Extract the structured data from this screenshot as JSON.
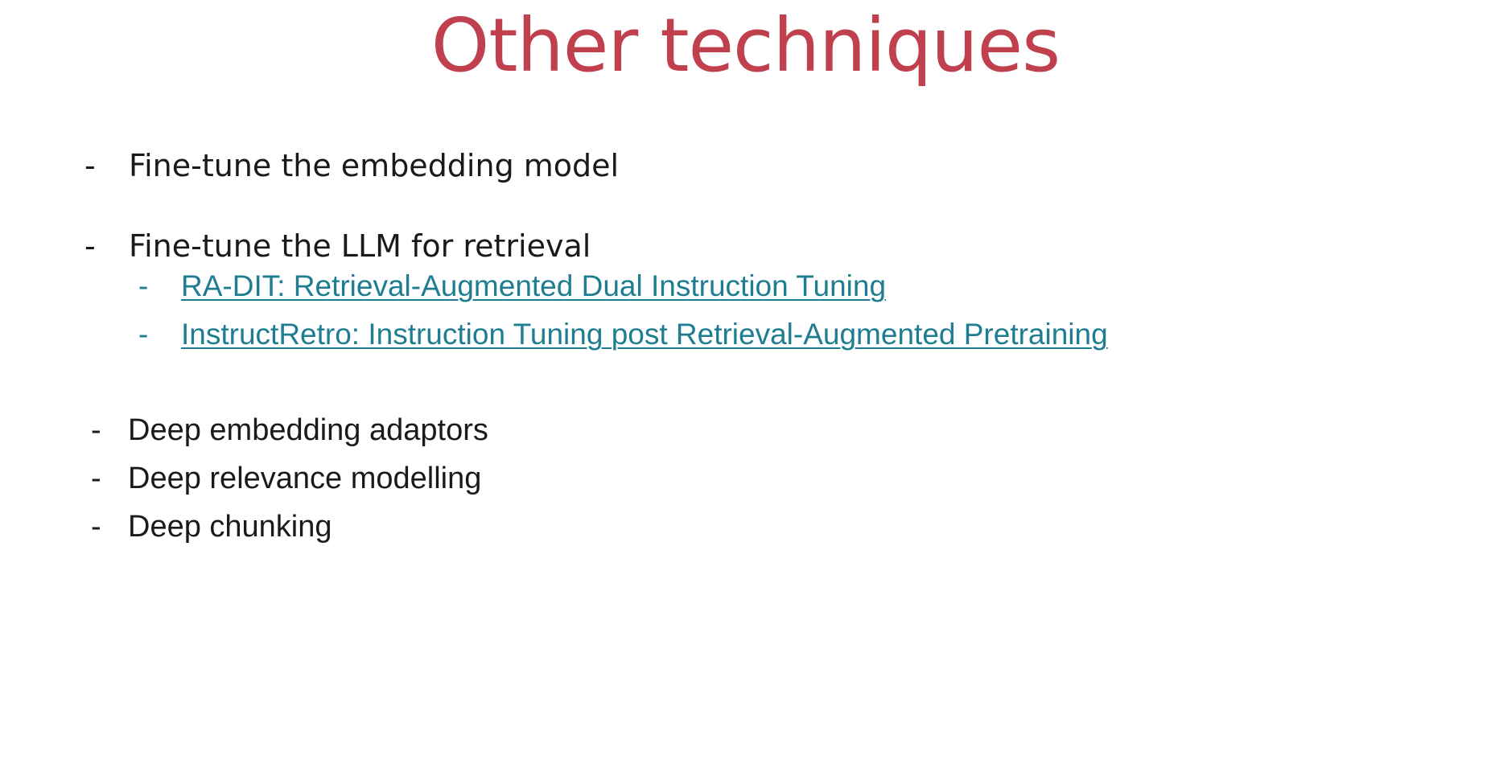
{
  "slide": {
    "title": "Other techniques",
    "bullet_marker": "-",
    "top_items": [
      {
        "text": "Fine-tune the embedding model"
      },
      {
        "text": "Fine-tune the LLM for retrieval"
      }
    ],
    "links": [
      {
        "text": "RA-DIT: Retrieval-Augmented Dual Instruction Tuning"
      },
      {
        "text": "InstructRetro: Instruction Tuning post Retrieval-Augmented Pretraining"
      }
    ],
    "bottom_items": [
      {
        "text": "Deep embedding adaptors"
      },
      {
        "text": "Deep relevance modelling"
      },
      {
        "text": "Deep chunking"
      }
    ]
  },
  "colors": {
    "title": "#c0404d",
    "body_text": "#1a1a1a",
    "link": "#1f7d91",
    "background": "#ffffff"
  }
}
